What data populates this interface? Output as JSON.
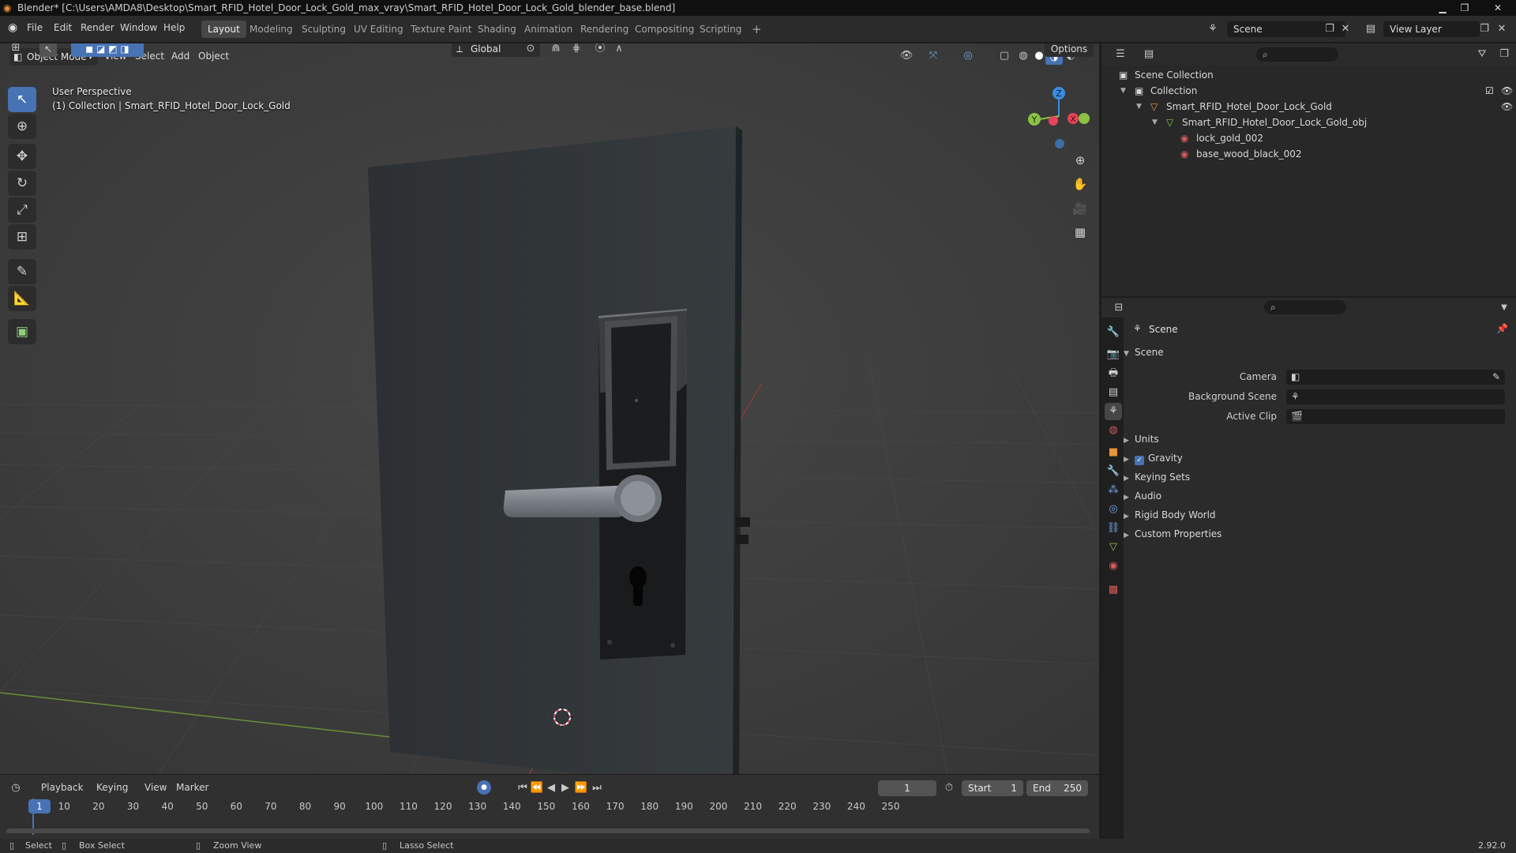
{
  "window": {
    "title": "Blender* [C:\\Users\\AMDA8\\Desktop\\Smart_RFID_Hotel_Door_Lock_Gold_max_vray\\Smart_RFID_Hotel_Door_Lock_Gold_blender_base.blend]",
    "version": "2.92.0"
  },
  "menu": [
    "File",
    "Edit",
    "Render",
    "Window",
    "Help"
  ],
  "workspaces": [
    "Layout",
    "Modeling",
    "Sculpting",
    "UV Editing",
    "Texture Paint",
    "Shading",
    "Animation",
    "Rendering",
    "Compositing",
    "Scripting"
  ],
  "active_workspace": "Layout",
  "scene_selector": "Scene",
  "view_layer": "View Layer",
  "viewport": {
    "mode": "Object Mode",
    "menus": [
      "View",
      "Select",
      "Add",
      "Object"
    ],
    "transform_orientation": "Global",
    "options_label": "Options",
    "perspective_label": "User Perspective",
    "collection_label": "(1) Collection | Smart_RFID_Hotel_Door_Lock_Gold",
    "gizmo": {
      "x": "X",
      "y": "Y",
      "z": "Z"
    }
  },
  "timeline": {
    "menus": [
      "Playback",
      "Keying",
      "View",
      "Marker"
    ],
    "current_frame": "1",
    "start_label": "Start",
    "start": "1",
    "end_label": "End",
    "end": "250",
    "ticks": [
      "1",
      "10",
      "20",
      "30",
      "40",
      "50",
      "60",
      "70",
      "80",
      "90",
      "100",
      "110",
      "120",
      "130",
      "140",
      "150",
      "160",
      "170",
      "180",
      "190",
      "200",
      "210",
      "220",
      "230",
      "240",
      "250"
    ]
  },
  "status": {
    "select": "Select",
    "box_select": "Box Select",
    "zoom_view": "Zoom View",
    "lasso_select": "Lasso Select"
  },
  "outliner": {
    "root": "Scene Collection",
    "collection": "Collection",
    "object": "Smart_RFID_Hotel_Door_Lock_Gold",
    "mesh": "Smart_RFID_Hotel_Door_Lock_Gold_obj",
    "materials": [
      "lock_gold_002",
      "base_wood_black_002"
    ]
  },
  "properties": {
    "context": "Scene",
    "panel_title": "Scene",
    "fields": {
      "camera": "Camera",
      "background_scene": "Background Scene",
      "active_clip": "Active Clip"
    },
    "subpanels": [
      "Units",
      "Gravity",
      "Keying Sets",
      "Audio",
      "Rigid Body World",
      "Custom Properties"
    ]
  },
  "colors": {
    "accent": "#4772b3",
    "axis_x": "#e5445a",
    "axis_y": "#8bc244",
    "axis_z": "#3b8ce0",
    "object_orange": "#e8943a"
  }
}
